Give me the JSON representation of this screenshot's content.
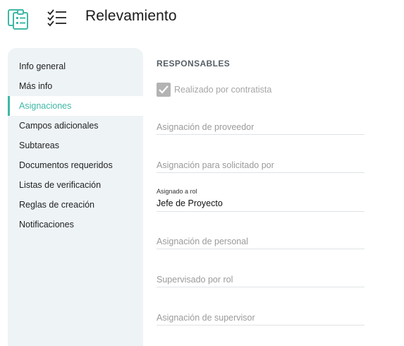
{
  "header": {
    "title": "Relevamiento",
    "app_icon": "clipboard-checklist-icon",
    "menu_icon": "checklist-icon",
    "accent_color": "#3fb7a6"
  },
  "sidebar": {
    "items": [
      {
        "label": "Info general",
        "active": false
      },
      {
        "label": "Más info",
        "active": false
      },
      {
        "label": "Asignaciones",
        "active": true
      },
      {
        "label": "Campos adicionales",
        "active": false
      },
      {
        "label": "Subtareas",
        "active": false
      },
      {
        "label": "Documentos requeridos",
        "active": false
      },
      {
        "label": "Listas de verificación",
        "active": false
      },
      {
        "label": "Reglas de creación",
        "active": false
      },
      {
        "label": "Notificaciones",
        "active": false
      }
    ]
  },
  "main": {
    "section_title": "RESPONSABLES",
    "checkbox": {
      "label": "Realizado por contratista",
      "checked": true,
      "disabled": true
    },
    "fields": {
      "proveedor": {
        "placeholder": "Asignación de proveedor",
        "value": ""
      },
      "solicitado": {
        "placeholder": "Asignación para solicitado por",
        "value": ""
      },
      "rol": {
        "label": "Asignado a rol",
        "value": "Jefe de Proyecto"
      },
      "personal": {
        "placeholder": "Asignación de personal",
        "value": ""
      },
      "supervisado": {
        "placeholder": "Supervisado por rol",
        "value": ""
      },
      "supervisor": {
        "placeholder": "Asignación de supervisor",
        "value": ""
      }
    }
  }
}
